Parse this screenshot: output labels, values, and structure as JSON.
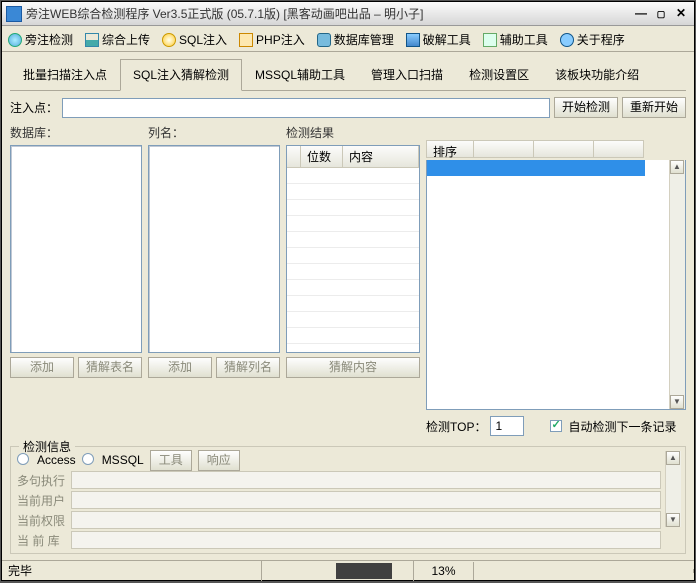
{
  "window": {
    "title": "旁注WEB综合检测程序 Ver3.5正式版 (05.7.1版) [黑客动画吧出品 – 明小子]"
  },
  "main_tabs": [
    {
      "label": "旁注检测",
      "icon": "globe-icon"
    },
    {
      "label": "综合上传",
      "icon": "chart-icon"
    },
    {
      "label": "SQL注入",
      "icon": "sql-icon"
    },
    {
      "label": "PHP注入",
      "icon": "php-icon"
    },
    {
      "label": "数据库管理",
      "icon": "db-icon"
    },
    {
      "label": "破解工具",
      "icon": "tool-icon"
    },
    {
      "label": "辅助工具",
      "icon": "doc-icon"
    },
    {
      "label": "关于程序",
      "icon": "help-icon"
    }
  ],
  "sub_tabs": [
    {
      "label": "批量扫描注入点"
    },
    {
      "label": "SQL注入猜解检测"
    },
    {
      "label": "MSSQL辅助工具"
    },
    {
      "label": "管理入口扫描"
    },
    {
      "label": "检测设置区"
    },
    {
      "label": "该板块功能介绍"
    }
  ],
  "inject_label": "注入点：",
  "btn_start": "开始检测",
  "btn_restart": "重新开始",
  "db_group": {
    "label": "数据库：",
    "btn_add": "添加",
    "btn_guess": "猜解表名"
  },
  "col_group": {
    "label": "列名：",
    "btn_add": "添加",
    "btn_guess": "猜解列名"
  },
  "res_group": {
    "label": "检测结果",
    "col_bits": "位数",
    "col_content": "内容",
    "btn_guess": "猜解内容"
  },
  "right_group": {
    "col_sort": "排序"
  },
  "top_label": "检测TOP：",
  "top_value": "1",
  "auto_next": "自动检测下一条记录",
  "det_info": {
    "legend": "检测信息",
    "radio_access": "Access",
    "radio_mssql": "MSSQL",
    "btn_tool": "工具",
    "btn_resp": "响应",
    "rows": [
      {
        "label": "多句执行"
      },
      {
        "label": "当前用户"
      },
      {
        "label": "当前权限"
      },
      {
        "label": "当 前 库"
      }
    ]
  },
  "status": {
    "ready": "完毕",
    "percent": "13%"
  }
}
